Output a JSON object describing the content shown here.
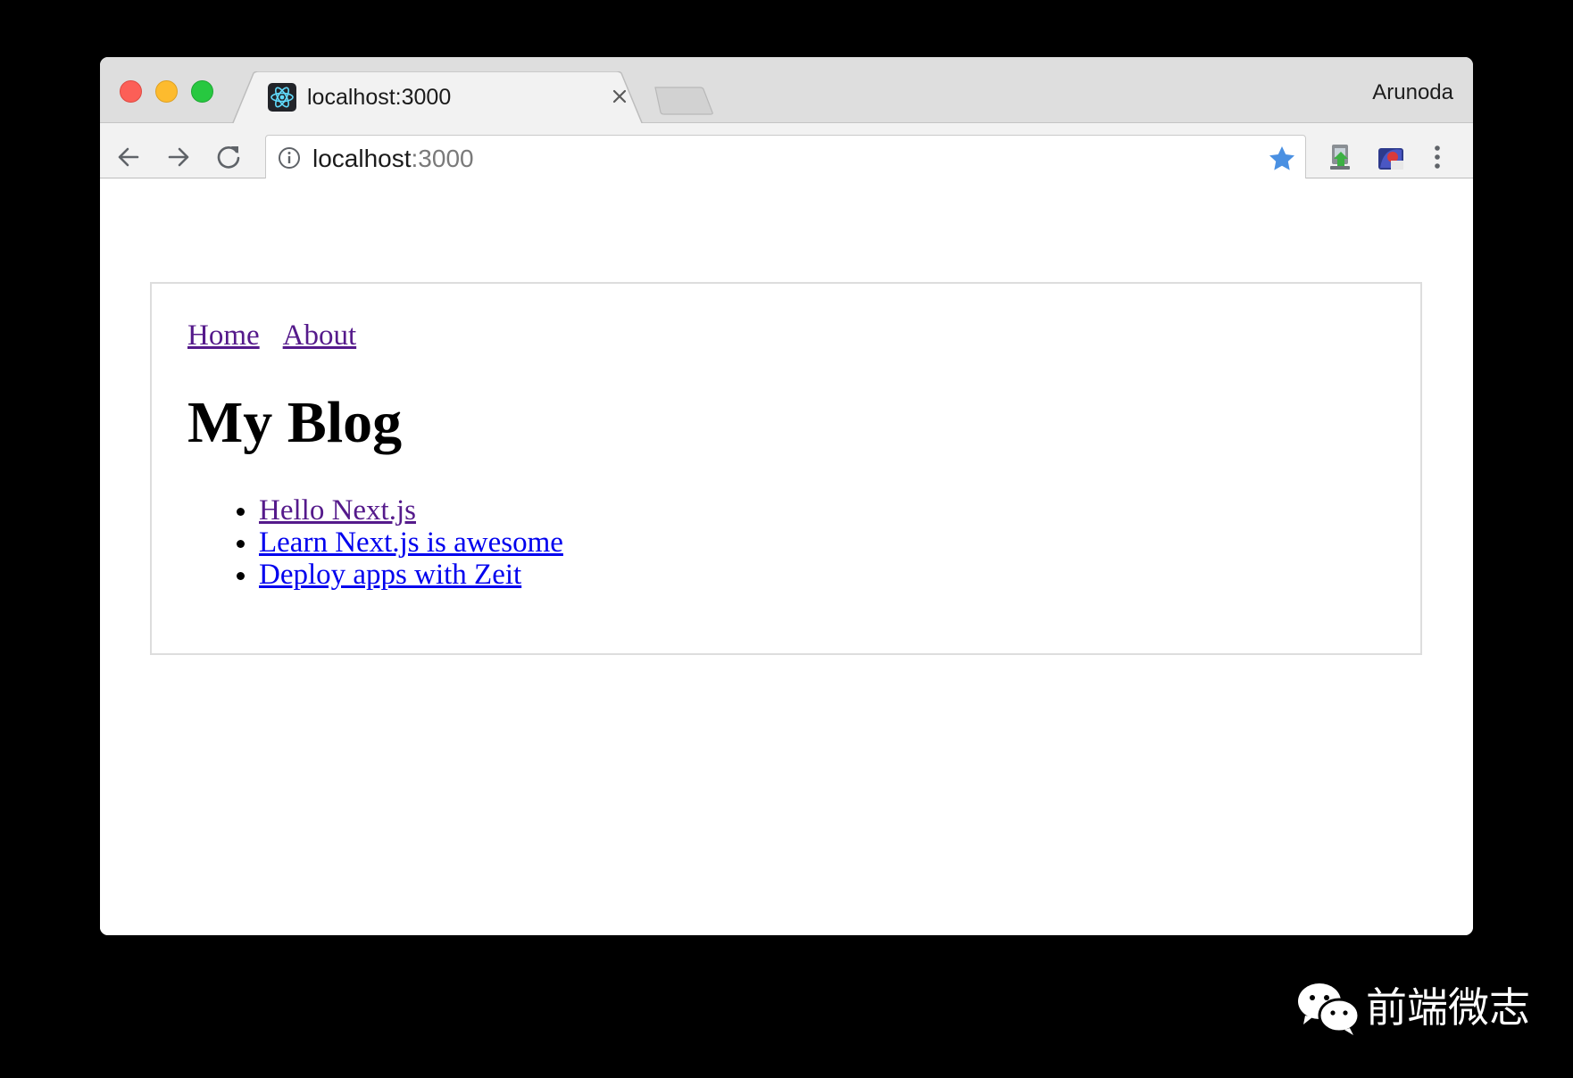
{
  "tab": {
    "title": "localhost:3000",
    "favicon": "react-icon"
  },
  "profile": {
    "name": "Arunoda"
  },
  "omnibox": {
    "host": "localhost",
    "port": ":3000"
  },
  "page": {
    "nav": {
      "home": "Home",
      "about": "About"
    },
    "title": "My Blog",
    "posts": [
      "Hello Next.js",
      "Learn Next.js is awesome",
      "Deploy apps with Zeit"
    ]
  },
  "watermark": {
    "text": "前端微志"
  },
  "colors": {
    "visited_link": "#551a8b",
    "unvisited_link": "#0000ee",
    "bookmark_star": "#4a90e2"
  }
}
